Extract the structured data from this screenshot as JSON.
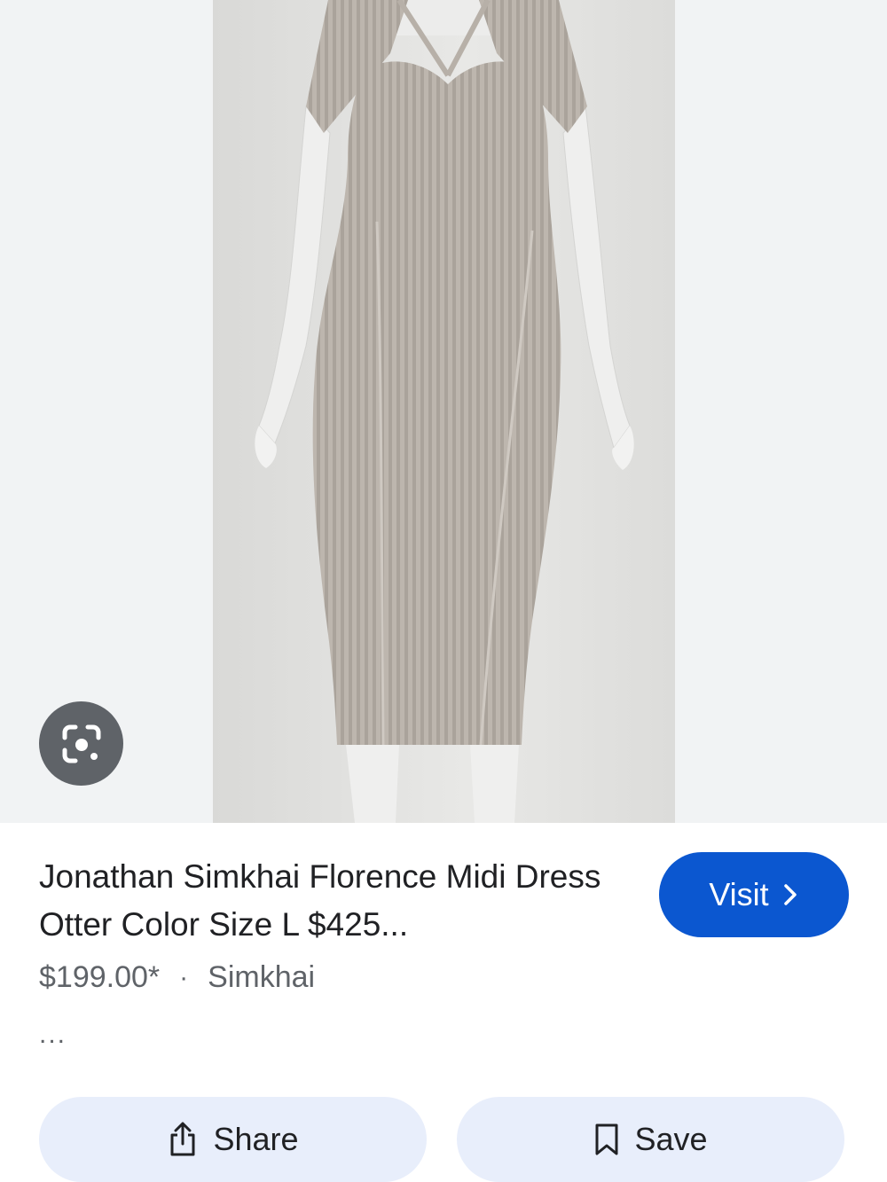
{
  "product": {
    "title": "Jonathan Simkhai Florence Midi Dress Otter Color Size L $425...",
    "price": "$199.00*",
    "separator": "·",
    "seller": "Simkhai",
    "more": "..."
  },
  "actions": {
    "visit_label": "Visit",
    "share_label": "Share",
    "save_label": "Save"
  },
  "icons": {
    "lens": "google-lens-icon",
    "visit": "chevron-right-icon",
    "share": "share-icon",
    "save": "bookmark-icon"
  },
  "colors": {
    "visit_button": "#0b57d0",
    "action_button_bg": "#e8eefb",
    "lens_button": "#5f6368"
  }
}
